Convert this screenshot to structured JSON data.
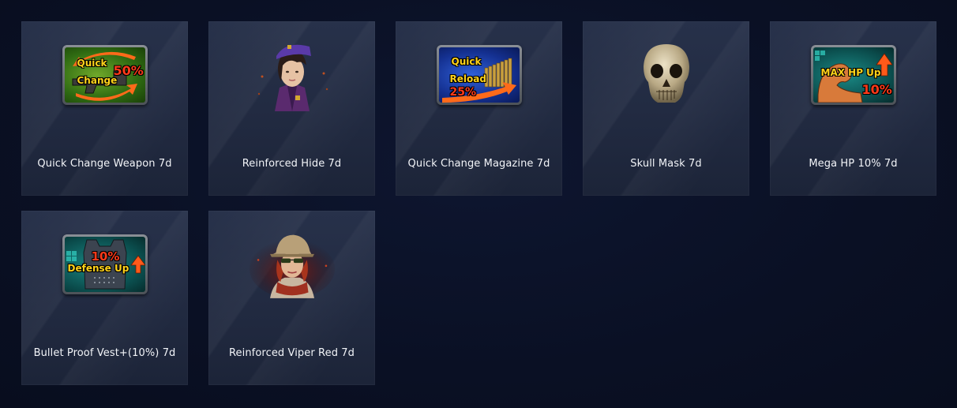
{
  "items": [
    {
      "label": "Quick Change Weapon 7d",
      "icon": "quick-change-weapon-icon",
      "badge": {
        "line1": "Quick",
        "line2": "Change",
        "value": "50%"
      }
    },
    {
      "label": "Reinforced Hide 7d",
      "icon": "character-portrait-icon"
    },
    {
      "label": "Quick Change Magazine 7d",
      "icon": "quick-reload-icon",
      "badge": {
        "line1": "Quick",
        "line2": "Reload",
        "value": "25%"
      }
    },
    {
      "label": "Skull Mask 7d",
      "icon": "skull-mask-icon"
    },
    {
      "label": "Mega HP 10% 7d",
      "icon": "max-hp-up-icon",
      "badge": {
        "line1": "MAX HP Up",
        "value": "10%"
      }
    },
    {
      "label": "Bullet Proof Vest+(10%) 7d",
      "icon": "defense-up-icon",
      "badge": {
        "line1": "Defense Up",
        "value": "10%"
      }
    },
    {
      "label": "Reinforced Viper Red 7d",
      "icon": "character-portrait-icon"
    }
  ],
  "colors": {
    "background": "#0b1126",
    "card": "#242d45",
    "label_text": "#f2f4f8",
    "badge_yellow": "#ffd21a",
    "badge_red": "#ff3a1a"
  }
}
